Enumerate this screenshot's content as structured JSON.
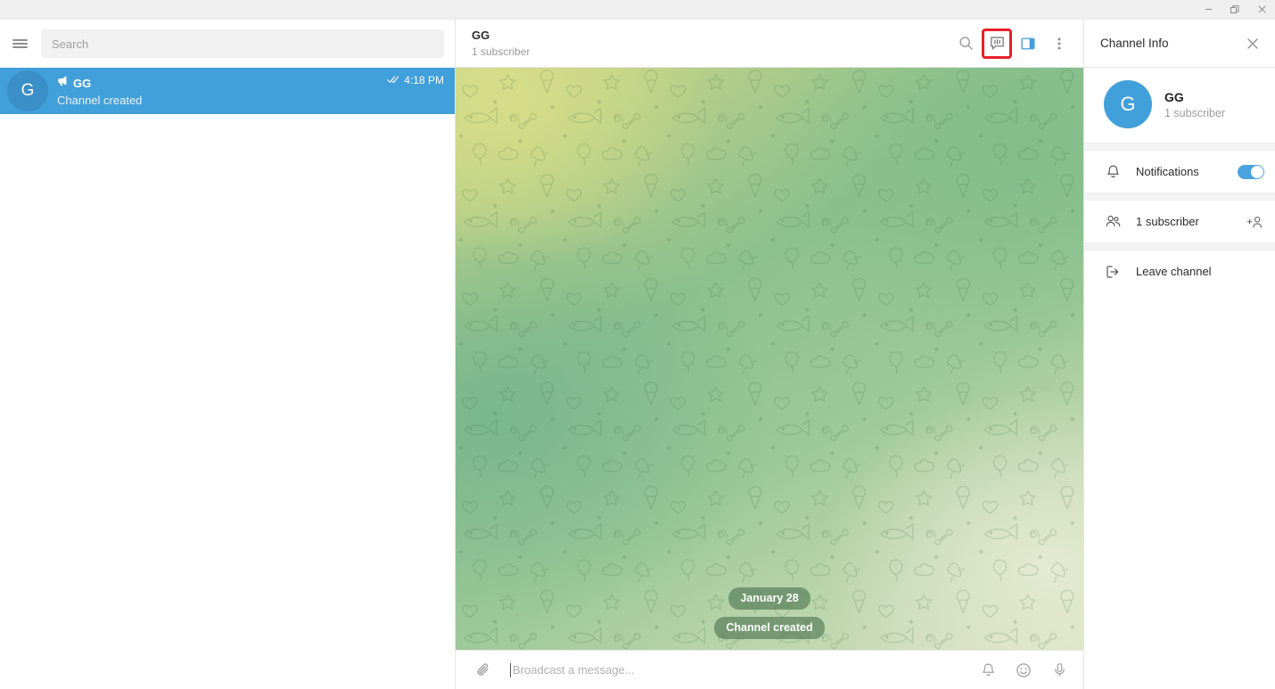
{
  "window": {
    "minimize_label": "Minimize",
    "restore_label": "Restore",
    "close_label": "Close"
  },
  "sidebar": {
    "menu_icon": "hamburger-menu-icon",
    "search": {
      "placeholder": "Search",
      "value": ""
    },
    "chats": [
      {
        "avatar_letter": "G",
        "title": "GG",
        "badge_icon": "megaphone-icon",
        "preview": "Channel created",
        "time": "4:18 PM",
        "read_status_icon": "double-check-icon"
      }
    ]
  },
  "chat_header": {
    "title": "GG",
    "subtitle": "1 subscriber",
    "actions": [
      {
        "name": "search-icon",
        "label": "Search messages",
        "highlighted": false
      },
      {
        "name": "discussion-icon",
        "label": "Discussion",
        "highlighted": true
      },
      {
        "name": "panel-toggle-icon",
        "label": "Toggle info panel",
        "highlighted": false
      },
      {
        "name": "more-options-icon",
        "label": "More",
        "highlighted": false
      }
    ]
  },
  "conversation": {
    "date_divider": "January 28",
    "service_message": "Channel created"
  },
  "composer": {
    "attach_icon": "paperclip-icon",
    "placeholder": "Broadcast a message...",
    "value": "",
    "actions": [
      {
        "name": "silent-bell-icon",
        "label": "Send without sound"
      },
      {
        "name": "emoji-icon",
        "label": "Emoji"
      },
      {
        "name": "microphone-icon",
        "label": "Record voice message"
      }
    ]
  },
  "info_panel": {
    "title": "Channel Info",
    "close_icon": "close-icon",
    "profile": {
      "avatar_letter": "G",
      "name": "GG",
      "subtitle": "1 subscriber"
    },
    "rows": [
      {
        "icon": "bell-icon",
        "label": "Notifications",
        "control": "toggle",
        "toggle_on": true
      },
      {
        "icon": "members-icon",
        "label": "1 subscriber",
        "control": "add-member",
        "action_icon": "add-person-icon"
      },
      {
        "icon": "leave-icon",
        "label": "Leave channel",
        "control": "none"
      }
    ]
  },
  "colors": {
    "accent": "#419fd9",
    "selected_chat": "#419fd9",
    "highlight_outline": "#e8202a",
    "toggle_on": "#4aa3de",
    "titlebar": "#efefef"
  }
}
